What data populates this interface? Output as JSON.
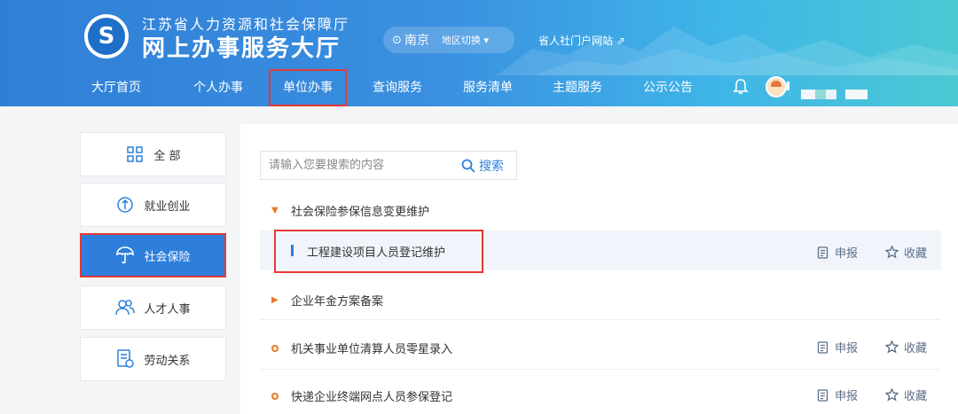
{
  "header": {
    "subtitle": "江苏省人力资源和社会保障厅",
    "title": "网上办事服务大厅",
    "region": {
      "city": "南京",
      "switch_label": "地区切换 ▾"
    },
    "portal_link": "省人社门户网站"
  },
  "nav": {
    "items": [
      {
        "label": "大厅首页"
      },
      {
        "label": "个人办事"
      },
      {
        "label": "单位办事"
      },
      {
        "label": "查询服务"
      },
      {
        "label": "服务清单"
      },
      {
        "label": "主题服务"
      },
      {
        "label": "公示公告"
      }
    ],
    "active": "单位办事"
  },
  "sidebar": {
    "items": [
      {
        "label": "全 部",
        "icon": "grid-icon"
      },
      {
        "label": "就业创业",
        "icon": "employment-icon"
      },
      {
        "label": "社会保险",
        "icon": "umbrella-icon"
      },
      {
        "label": "人才人事",
        "icon": "people-icon"
      },
      {
        "label": "劳动关系",
        "icon": "document-icon"
      }
    ],
    "active": "社会保险"
  },
  "search": {
    "placeholder": "请输入您要搜索的内容",
    "button_label": "搜索"
  },
  "services": {
    "cat1": "社会保险参保信息变更维护",
    "cat1_sub": "工程建设项目人员登记维护",
    "cat2": "企业年金方案备案",
    "item3": "机关事业单位清算人员零星录入",
    "item4": "快递企业终端网点人员参保登记"
  },
  "actions": {
    "apply_label": "申报",
    "favorite_label": "收藏"
  },
  "colors": {
    "primary": "#2d7fdb",
    "highlight_border": "#e53935",
    "accent_orange": "#e87a2a"
  }
}
